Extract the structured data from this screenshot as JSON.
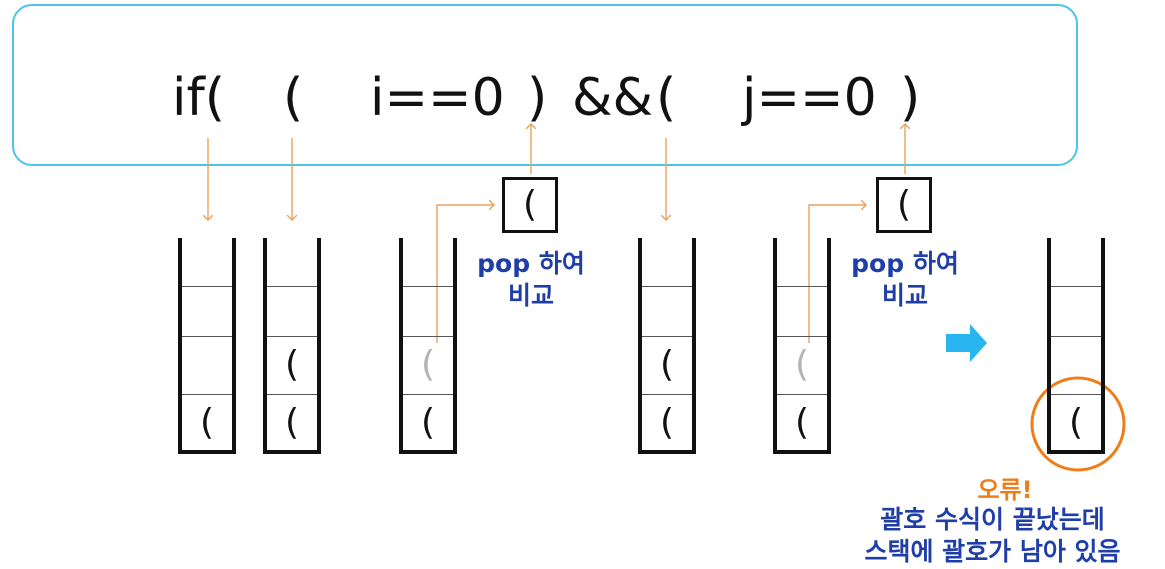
{
  "expression": {
    "tokens": [
      "if(",
      "(",
      "i==0",
      ")",
      "&&",
      "(",
      "j==0",
      ")"
    ]
  },
  "stacks": [
    {
      "cells": [
        "(",
        "",
        ""
      ],
      "ghost": [
        false,
        false,
        false
      ]
    },
    {
      "cells": [
        "(",
        "(",
        ""
      ],
      "ghost": [
        false,
        false,
        false
      ]
    },
    {
      "cells": [
        "(",
        "(",
        ""
      ],
      "ghost": [
        false,
        true,
        false
      ]
    },
    {
      "cells": [
        "(",
        "(",
        ""
      ],
      "ghost": [
        false,
        false,
        false
      ]
    },
    {
      "cells": [
        "(",
        "(",
        ""
      ],
      "ghost": [
        false,
        true,
        false
      ]
    },
    {
      "cells": [
        "(",
        "",
        ""
      ],
      "ghost": [
        false,
        false,
        false
      ]
    }
  ],
  "pop_steps": [
    {
      "popped": "(",
      "label_line1": "pop 하여",
      "label_line2": "비교"
    },
    {
      "popped": "(",
      "label_line1": "pop 하여",
      "label_line2": "비교"
    }
  ],
  "result": {
    "error_title": "오류!",
    "error_line1": "괄호 수식이 끝났는데",
    "error_line2": "스택에 괄호가 남아 있음"
  },
  "colors": {
    "frame": "#4cc3ea",
    "arrow": "#e8a35f",
    "next_arrow": "#29b6f0",
    "label": "#1f3ea8",
    "error": "#ef7d1a",
    "ghost": "#b4b4b4"
  }
}
